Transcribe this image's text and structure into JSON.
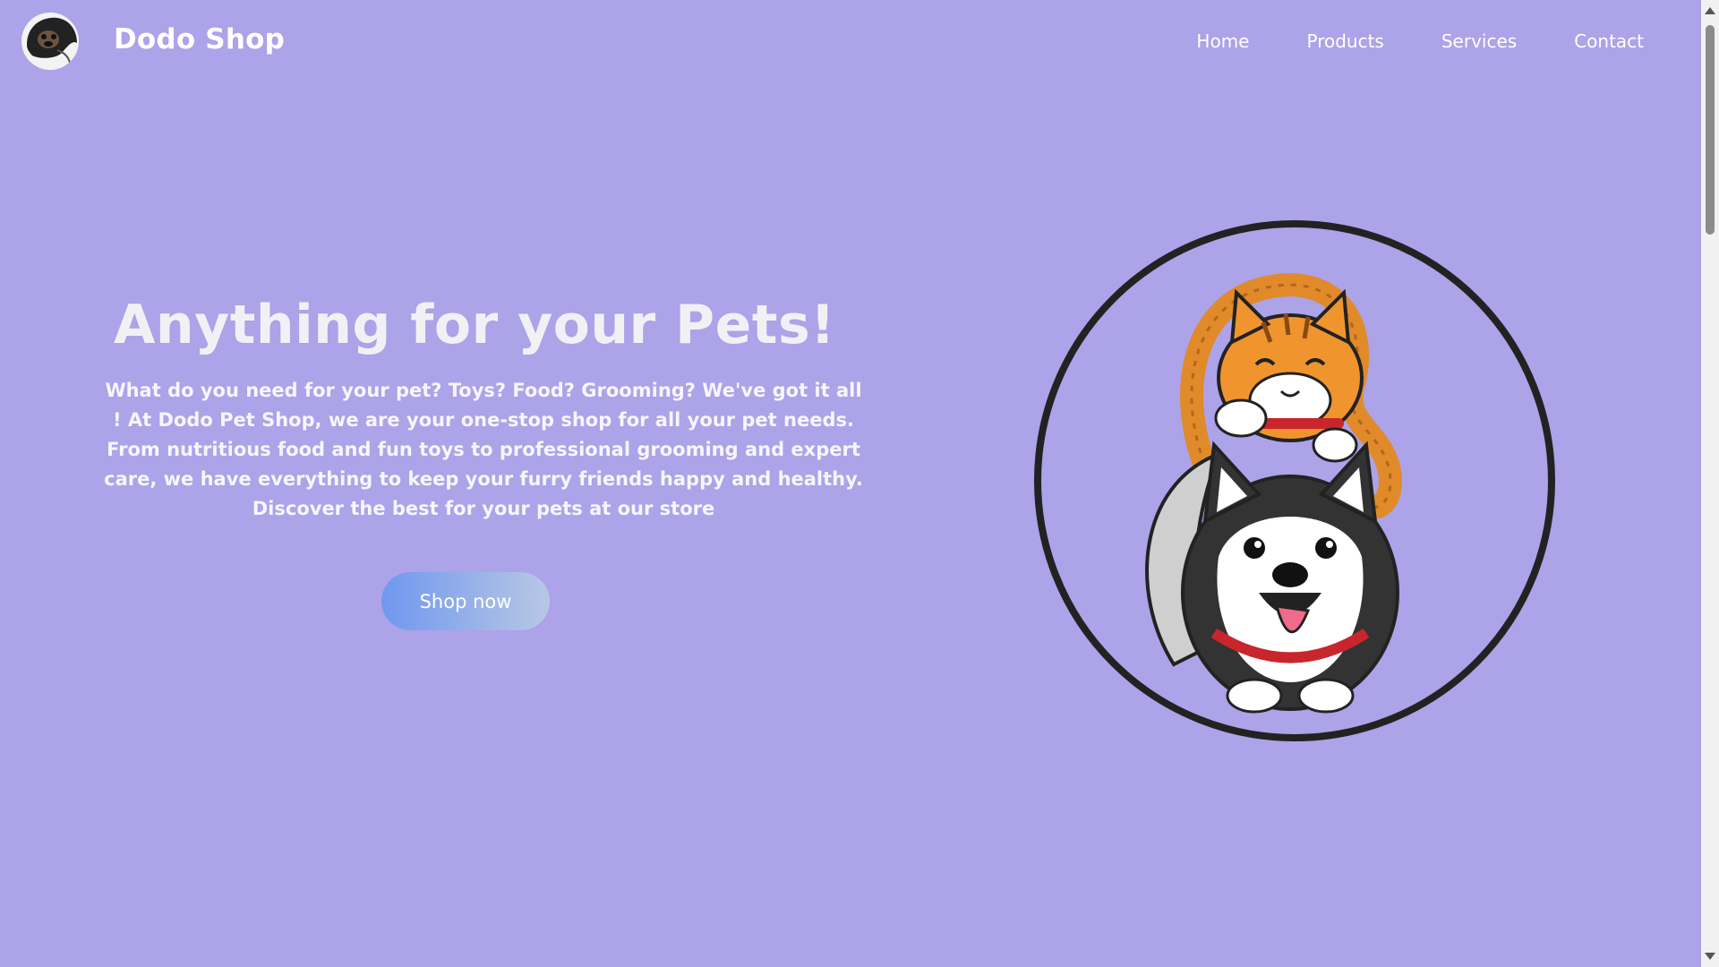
{
  "header": {
    "brand": "Dodo Shop",
    "logo_icon": "pug-dog-logo-icon",
    "nav": [
      "Home",
      "Products",
      "Services",
      "Contact"
    ]
  },
  "hero": {
    "title": "Anything for your Pets!",
    "description": "What do you need for your pet? Toys? Food? Grooming? We've got it all ! At Dodo Pet Shop, we are your one-stop shop for all your pet needs. From nutritious food and fun toys to professional grooming and expert care, we have everything to keep your furry friends happy and healthy. Discover the best for your pets at our store",
    "button_label": "Shop now",
    "image_icon": "cat-and-husky-illustration-icon"
  },
  "colors": {
    "background": "#aca3e9",
    "button_gradient_start": "#6f98ee",
    "button_gradient_end": "#b9c7e5",
    "text": "#ffffff"
  }
}
